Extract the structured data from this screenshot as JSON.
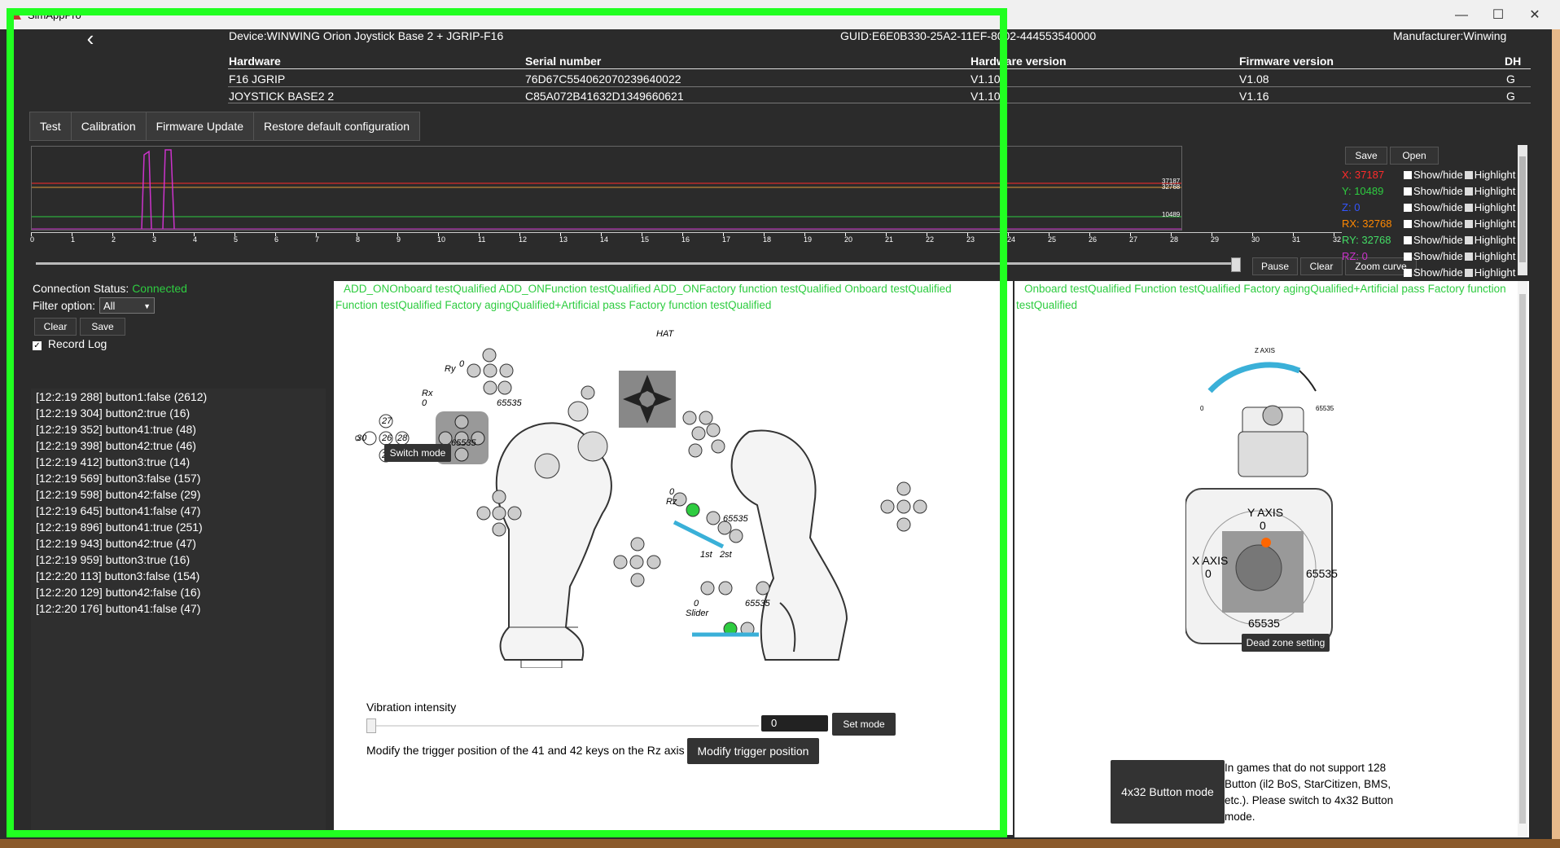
{
  "app": {
    "title": "SimAppPro"
  },
  "window": {
    "minimize": "—",
    "maximize": "☐",
    "close": "✕"
  },
  "device": {
    "name": "Device:WINWING Orion Joystick Base 2 + JGRIP-F16",
    "guid": "GUID:E6E0B330-25A2-11EF-8002-444553540000",
    "manufacturer": "Manufacturer:Winwing"
  },
  "table": {
    "headers": [
      "Hardware",
      "Serial number",
      "Hardware version",
      "Firmware version",
      "DH"
    ],
    "rows": [
      [
        "F16 JGRIP",
        "76D67C554062070239640022",
        "V1.10",
        "V1.08",
        "G"
      ],
      [
        "JOYSTICK BASE2 2",
        "C85A072B41632D1349660621",
        "V1.10",
        "V1.16",
        "G"
      ]
    ]
  },
  "tabs": [
    "Test",
    "Calibration",
    "Firmware Update",
    "Restore default configuration"
  ],
  "graph": {
    "y_labels": [
      "37187",
      "32768",
      "10489"
    ],
    "ruler_ticks": [
      "0",
      "1",
      "2",
      "3",
      "4",
      "5",
      "6",
      "7",
      "8",
      "9",
      "10",
      "11",
      "12",
      "13",
      "14",
      "15",
      "16",
      "17",
      "18",
      "19",
      "20",
      "21",
      "22",
      "23",
      "24",
      "25",
      "26",
      "27",
      "28",
      "29",
      "30",
      "31",
      "32"
    ]
  },
  "graph_buttons": {
    "save": "Save",
    "open": "Open",
    "pause": "Pause",
    "clear": "Clear",
    "zoom": "Zoom curve"
  },
  "legend": [
    {
      "axis": "X:",
      "value": "37187",
      "color": "#ff2b2b",
      "show": "Show/hide",
      "highlight": "Highlight"
    },
    {
      "axis": "Y:",
      "value": "10489",
      "color": "#2ecc40",
      "show": "Show/hide",
      "highlight": "Highlight"
    },
    {
      "axis": "Z:",
      "value": "0",
      "color": "#3355ff",
      "show": "Show/hide",
      "highlight": "Highlight"
    },
    {
      "axis": "RX:",
      "value": "32768",
      "color": "#ff8800",
      "show": "Show/hide",
      "highlight": "Highlight"
    },
    {
      "axis": "RY:",
      "value": "32768",
      "color": "#44dd66",
      "show": "Show/hide",
      "highlight": "Highlight"
    },
    {
      "axis": "RZ:",
      "value": "0",
      "color": "#cc33cc",
      "show": "Show/hide",
      "highlight": "Highlight"
    },
    {
      "axis": "",
      "value": "",
      "color": "#ffffff",
      "show": "Show/hide",
      "highlight": "Highlight"
    }
  ],
  "connection": {
    "label": "Connection Status:",
    "status": "Connected"
  },
  "filter": {
    "label": "Filter option:",
    "value": "All"
  },
  "log_buttons": {
    "clear": "Clear",
    "save": "Save"
  },
  "record_log": "Record Log",
  "log": [
    "[12:2:19 288] button1:false (2612)",
    "[12:2:19 304] button2:true (16)",
    "[12:2:19 352] button41:true (48)",
    "[12:2:19 398] button42:true (46)",
    "[12:2:19 412] button3:true (14)",
    "[12:2:19 569] button3:false (157)",
    "[12:2:19 598] button42:false (29)",
    "[12:2:19 645] button41:false (47)",
    "[12:2:19 896] button41:true (251)",
    "[12:2:19 943] button42:true (47)",
    "[12:2:19 959] button3:true (16)",
    "[12:2:20 113] button3:false (154)",
    "[12:2:20 129] button42:false (16)",
    "[12:2:20 176] button41:false (47)"
  ],
  "tests_left": "ADD_ONOnboard testQualified   ADD_ONFunction testQualified   ADD_ONFactory function testQualified   Onboard testQualified   Function testQualified Factory agingQualified+Artificial pass   Factory function testQualified",
  "tests_right": "Onboard testQualified   Function testQualified Factory agingQualified+Artificial pass   Factory function testQualified",
  "diagram": {
    "hat": "HAT",
    "ry": "Ry",
    "rx": "Rx",
    "zero": "0",
    "max": "65535",
    "rz": "Rz",
    "slider": "Slider",
    "first": "1st",
    "second": "2st",
    "hat_buttons": [
      "27",
      "30",
      "26",
      "28",
      "29"
    ]
  },
  "switch_mode": "Switch mode",
  "vibration": {
    "label": "Vibration intensity",
    "value": "0",
    "set_mode": "Set mode"
  },
  "trigger": {
    "text": "Modify the trigger position of the 41 and 42 keys on the Rz axis",
    "button": "Modify trigger position"
  },
  "axes": {
    "z_axis": "Z AXIS",
    "y_axis": "Y AXIS",
    "x_axis": "X AXIS",
    "zero": "0",
    "max": "65535",
    "dead_zone": "Dead zone setting"
  },
  "button_mode": {
    "label": "4x32 Button mode",
    "text": "In games that do not support 128 Button (il2 BoS, StarCitizen, BMS, etc.). Please switch to 4x32 Button mode."
  }
}
